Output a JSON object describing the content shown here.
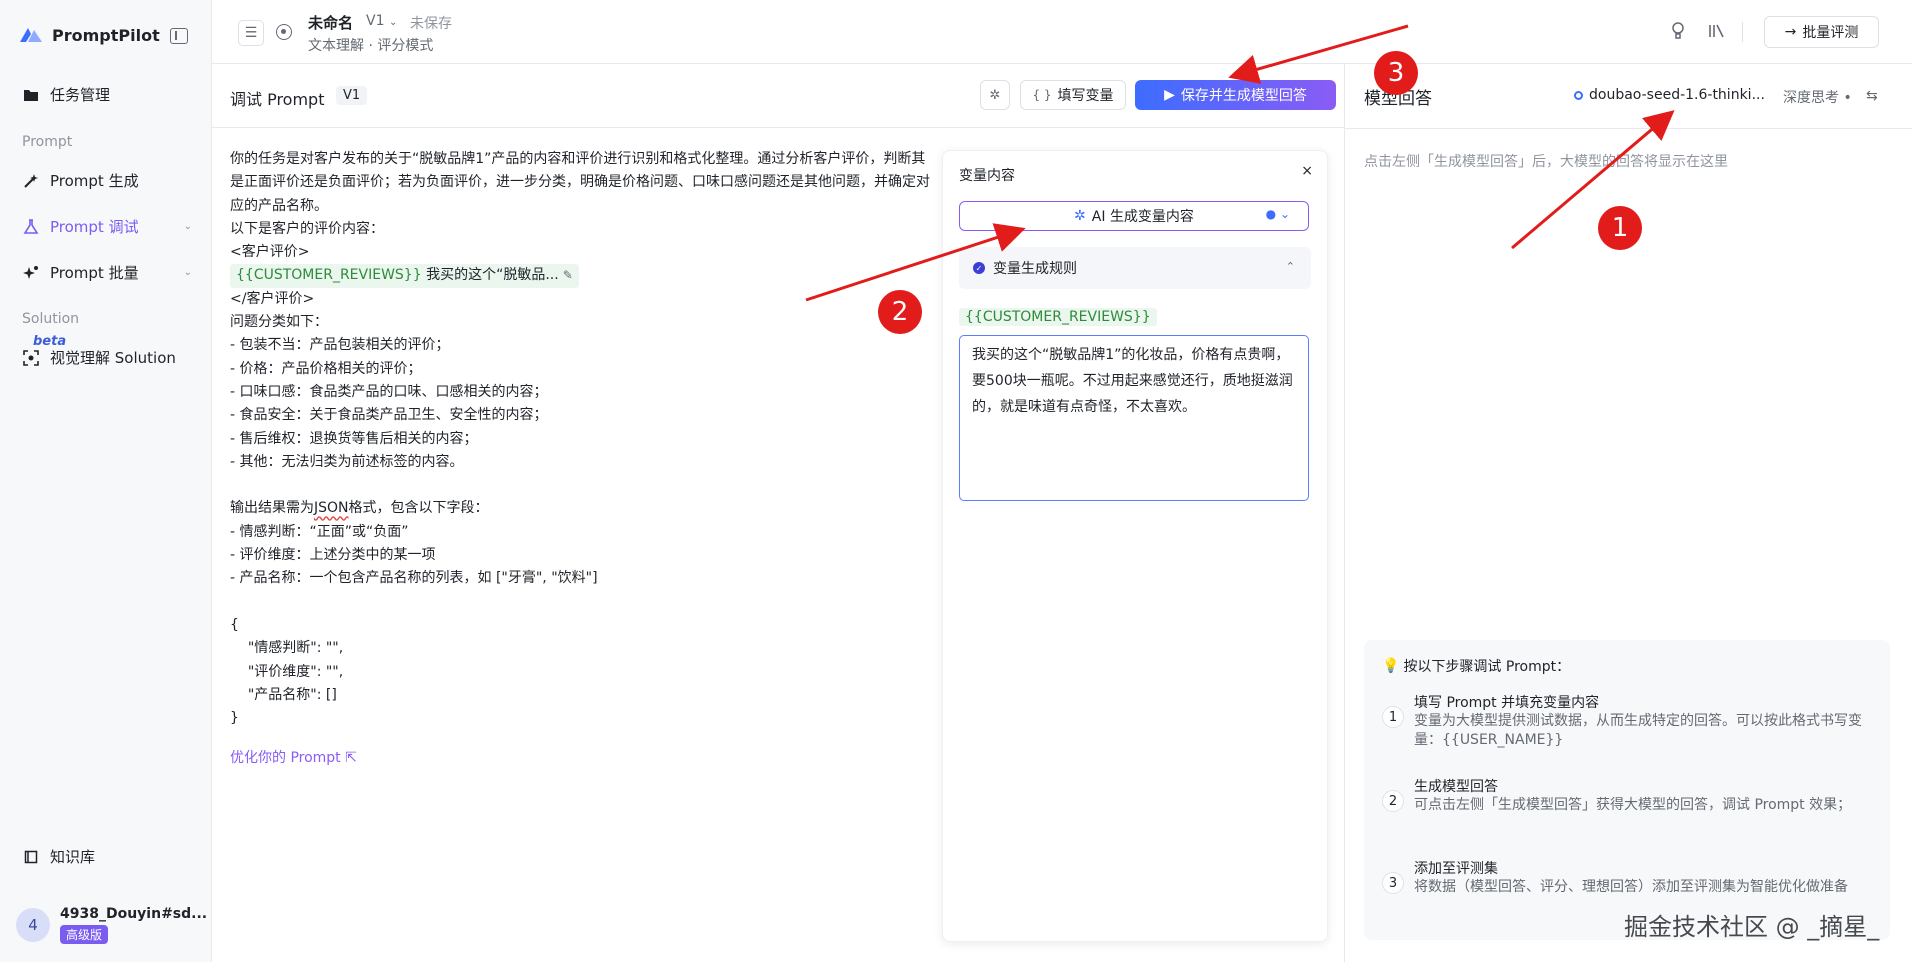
{
  "sidebar": {
    "brand": "PromptPilot",
    "nav": {
      "tasks": "任务管理",
      "section_prompt": "Prompt",
      "prompt_gen": "Prompt 生成",
      "prompt_debug": "Prompt 调试",
      "prompt_batch": "Prompt 批量",
      "section_solution": "Solution",
      "beta": "beta",
      "vision_solution": "视觉理解 Solution",
      "knowledge": "知识库"
    },
    "user": {
      "avatar": "4",
      "name": "4938_Douyin#sd...",
      "tier": "高级版"
    }
  },
  "topbar": {
    "title": "未命名",
    "version": "V1",
    "status": "未保存",
    "subtitle": "文本理解 · 评分模式",
    "batch_eval": "批量评测"
  },
  "editor": {
    "title": "调试 Prompt",
    "version": "V1",
    "fill_vars": "填写变量",
    "save_generate": "保存并生成模型回答",
    "prompt_part1": "你的任务是对客户发布的关于“脱敏品牌1”产品的内容和评价进行识别和格式化整理。通过分析客户评价，判断其是正面评价还是负面评价；若为负面评价，进一步分类，明确是价格问题、口味口感问题还是其他问题，并确定对应的产品名称。\n以下是客户的评价内容：\n<客户评价>",
    "var_name": "{{CUSTOMER_REVIEWS}}",
    "var_value": " 我买的这个“脱敏品...",
    "prompt_part2": "</客户评价>\n问题分类如下：\n- 包装不当：产品包装相关的评价；\n- 价格：产品价格相关的评价；\n- 口味口感：食品类产品的口味、口感相关的内容；\n- 食品安全：关于食品类产品卫生、安全性的内容；\n- 售后维权：退换货等售后相关的内容；\n- 其他：无法归类为前述标签的内容。\n\n输出结果需为",
    "prompt_json": "JSON",
    "prompt_part3": "格式，包含以下字段：\n- 情感判断：“正面”或“负面”\n- 评价维度：上述分类中的某一项\n- 产品名称：一个包含产品名称的列表，如 [\"牙膏\", \"饮料\"]\n\n{\n    \"情感判断\": \"\",\n    \"评价维度\": \"\",\n    \"产品名称\": []\n}",
    "optimize": "优化你的 Prompt ⇱"
  },
  "var_panel": {
    "title": "变量内容",
    "close": "×",
    "ai_generate": "AI 生成变量内容",
    "rule": "变量生成规则",
    "var_label": "{{CUSTOMER_REVIEWS}}",
    "var_value": "我买的这个“脱敏品牌1”的化妆品，价格有点贵啊，要500块一瓶呢。不过用起来感觉还行，质地挺滋润的，就是味道有点奇怪，不太喜欢。"
  },
  "response": {
    "title": "模型回答",
    "model": "doubao-seed-1.6-thinki...",
    "deep_think": "深度思考 •",
    "placeholder": "点击左侧「生成模型回答」后，大模型的回答将显示在这里",
    "steps_title": "按以下步骤调试 Prompt：",
    "steps": [
      {
        "num": "1",
        "title": "填写 Prompt 并填充变量内容",
        "desc": "变量为大模型提供测试数据，从而生成特定的回答。可以按此格式书写变量：{{USER_NAME}}"
      },
      {
        "num": "2",
        "title": "生成模型回答",
        "desc": "可点击左侧「生成模型回答」获得大模型的回答，调试 Prompt 效果；"
      },
      {
        "num": "3",
        "title": "添加至评测集",
        "desc": "将数据（模型回答、评分、理想回答）添加至评测集为智能优化做准备"
      }
    ]
  },
  "annotations": [
    "1",
    "2",
    "3"
  ],
  "watermark": "掘金技术社区 @ _摘星_",
  "colors": {
    "accent": "#7b5cf0",
    "primary": "#3d6dff",
    "annotation": "#e21b1b",
    "var_green": "#2e8b3a"
  }
}
